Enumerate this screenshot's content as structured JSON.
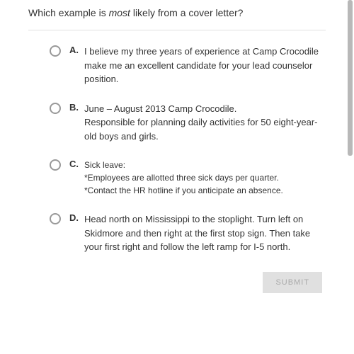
{
  "question": {
    "prefix": "Which example is ",
    "emphasis": "most",
    "suffix": " likely from a cover letter?"
  },
  "options": [
    {
      "label": "A.",
      "text": "I believe my three years of experience at Camp Crocodile make me an excellent candidate for your lead counselor position."
    },
    {
      "label": "B.",
      "text": "June – August 2013 Camp Crocodile.\nResponsible for planning daily activities for 50 eight-year-old boys and girls."
    },
    {
      "label": "C.",
      "text": "Sick leave:\n*Employees are allotted three sick days per quarter.\n*Contact the HR hotline if you anticipate an absence."
    },
    {
      "label": "D.",
      "text": "Head north on Mississippi to the stoplight. Turn left on Skidmore and then right at the first stop sign. Then take your first right and follow the left ramp for I-5 north."
    }
  ],
  "submit_label": "SUBMIT"
}
